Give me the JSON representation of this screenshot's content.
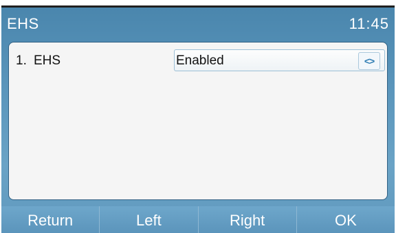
{
  "header": {
    "title": "EHS",
    "time": "11:45"
  },
  "list": {
    "items": [
      {
        "index": "1.",
        "label": "EHS",
        "value": "Enabled",
        "control_icon": "left-right-switch-icon"
      }
    ]
  },
  "softkeys": [
    {
      "label": "Return"
    },
    {
      "label": "Left"
    },
    {
      "label": "Right"
    },
    {
      "label": "OK"
    }
  ]
}
